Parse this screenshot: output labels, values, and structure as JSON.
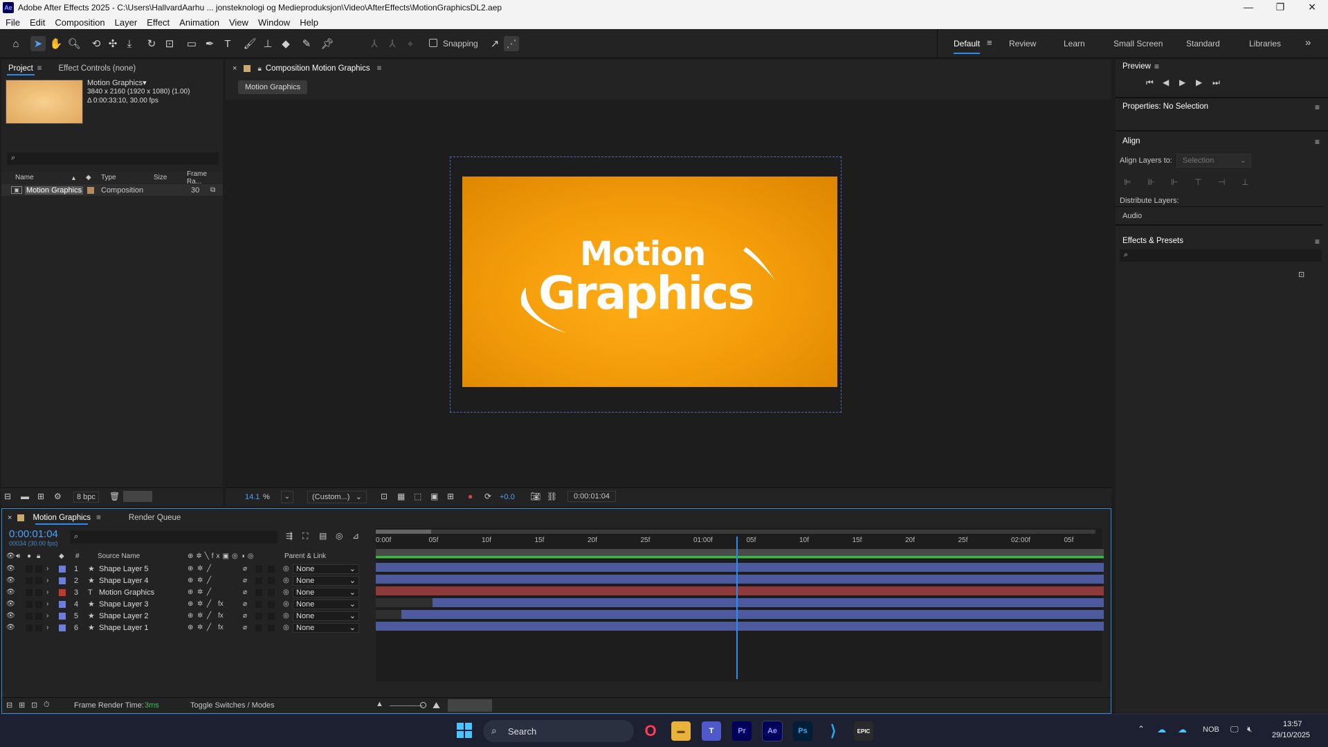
{
  "window": {
    "app_icon": "Ae",
    "title": "Adobe After Effects 2025 - C:\\Users\\HallvardAarhu ... jonsteknologi og Medieproduksjon\\Video\\AfterEffects\\MotionGraphicsDL2.aep",
    "minimize": "—",
    "maximize": "❐",
    "close": "✕"
  },
  "menu": [
    "File",
    "Edit",
    "Composition",
    "Layer",
    "Effect",
    "Animation",
    "View",
    "Window",
    "Help"
  ],
  "toolbar": {
    "snapping_label": "Snapping",
    "workspaces": [
      "Default",
      "Review",
      "Learn",
      "Small Screen",
      "Standard",
      "Libraries"
    ],
    "active_workspace": "Default",
    "more": "»"
  },
  "project": {
    "tab_project": "Project",
    "tab_effect_controls": "Effect Controls (none)",
    "item_name": "Motion Graphics▾",
    "item_res": "3840 x 2160  (1920 x 1080) (1.00)",
    "item_duration": "Δ 0:00:33:10, 30.00 fps",
    "search_icon": "⌕",
    "columns": {
      "name": "Name",
      "type": "Type",
      "size": "Size",
      "frame_rate": "Frame Ra..."
    },
    "rows": [
      {
        "name": "Motion Graphics",
        "type": "Composition",
        "size": "",
        "frame_rate": "30"
      }
    ],
    "bpc": "8 bpc"
  },
  "composition": {
    "tab_label": "Composition Motion Graphics",
    "breadcrumb": "Motion Graphics",
    "text_line1": "Motion",
    "text_line2": "Graphics",
    "bg_color_center": "#ffad14",
    "bg_color_edge": "#e08a00",
    "zoom": "14.1",
    "zoom_unit": "%",
    "resolution": "(Custom...)",
    "exposure": "+0.0",
    "timecode": "0:00:01:04"
  },
  "right": {
    "preview_title": "Preview",
    "properties_title": "Properties: No Selection",
    "align_title": "Align",
    "align_layers_to_label": "Align Layers to:",
    "align_layers_to_value": "Selection",
    "distribute_label": "Distribute Layers:",
    "audio_label": "Audio",
    "effects_title": "Effects & Presets"
  },
  "timeline": {
    "tab_label": "Motion Graphics",
    "render_queue": "Render Queue",
    "timecode": "0:00:01:04",
    "frames": "00034 (30.00 fps)",
    "col_num": "#",
    "col_source": "Source Name",
    "col_parent": "Parent & Link",
    "ruler_labels": [
      "0:00f",
      "05f",
      "10f",
      "15f",
      "20f",
      "25f",
      "01:00f",
      "05f",
      "10f",
      "15f",
      "20f",
      "25f",
      "02:00f",
      "05f"
    ],
    "layers": [
      {
        "num": "1",
        "icon": "★",
        "name": "Shape Layer 5",
        "parent": "None",
        "label_color": "#6b7fe0",
        "fx": "",
        "start": 0.0,
        "bar_color": "#4e5a9e"
      },
      {
        "num": "2",
        "icon": "★",
        "name": "Shape Layer 4",
        "parent": "None",
        "label_color": "#6b7fe0",
        "fx": "",
        "start": 0.0,
        "bar_color": "#4e5a9e"
      },
      {
        "num": "3",
        "icon": "T",
        "name": "Motion Graphics",
        "parent": "None",
        "label_color": "#c0392b",
        "fx": "",
        "start": 0.0,
        "bar_color": "#8f3a3a"
      },
      {
        "num": "4",
        "icon": "★",
        "name": "Shape Layer 3",
        "parent": "None",
        "label_color": "#6b7fe0",
        "fx": "fx",
        "start": 0.078,
        "bar_color": "#4e5a9e"
      },
      {
        "num": "5",
        "icon": "★",
        "name": "Shape Layer 2",
        "parent": "None",
        "label_color": "#6b7fe0",
        "fx": "fx",
        "start": 0.035,
        "bar_color": "#4e5a9e"
      },
      {
        "num": "6",
        "icon": "★",
        "name": "Shape Layer 1",
        "parent": "None",
        "label_color": "#6b7fe0",
        "fx": "fx",
        "start": 0.0,
        "bar_color": "#4e5a9e"
      }
    ],
    "playhead_fraction": 0.495,
    "frame_render_label": "Frame Render Time:",
    "frame_render_value": "3ms",
    "toggle_label": "Toggle Switches / Modes"
  },
  "taskbar": {
    "search": "Search",
    "language": "NOB",
    "time": "13:57",
    "date": "29/10/2025",
    "apps": [
      "Opera",
      "File Explorer",
      "Teams",
      "Pr",
      "Ae",
      "Ps",
      "VS Code",
      "Epic Games"
    ]
  }
}
